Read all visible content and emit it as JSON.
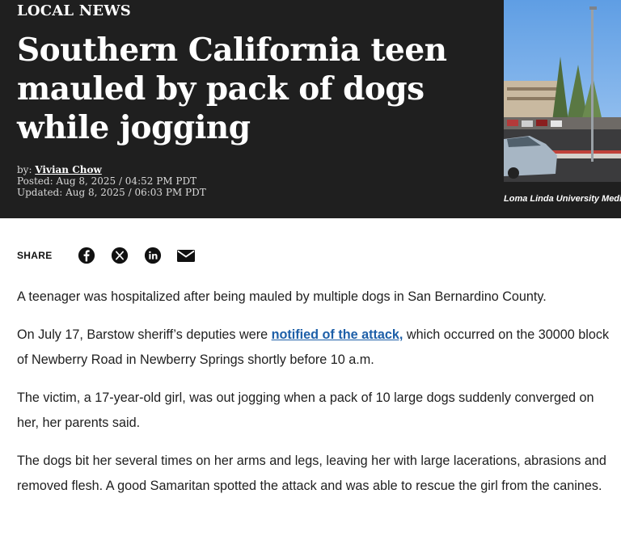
{
  "hero": {
    "kicker": "LOCAL NEWS",
    "headline": "Southern California teen mauled by pack of dogs while jogging",
    "byline_prefix": "by: ",
    "author": "Vivian Chow",
    "posted": "Posted: Aug 8, 2025 / 04:52 PM PDT",
    "updated": "Updated: Aug 8, 2025 / 06:03 PM PDT",
    "photo_caption": "Loma Linda University Medical Center",
    "colors": {
      "background": "#1f1f1f",
      "text": "#ffffff"
    }
  },
  "share": {
    "label": "SHARE",
    "icons": [
      "facebook-icon",
      "x-icon",
      "linkedin-icon",
      "email-icon"
    ]
  },
  "article": {
    "p1": "A teenager was hospitalized after being mauled by multiple dogs in San Bernardino County.",
    "p2_before": "On July 17, Barstow sheriff’s deputies were ",
    "p2_link": "notified of the attack,",
    "p2_after": " which occurred on the 30000 block of Newberry Road in Newberry Springs shortly before 10 a.m.",
    "p3": "The victim, a 17-year-old girl, was out jogging when a pack of 10 large dogs suddenly converged on her, her parents said.",
    "p4": "The dogs bit her several times on her arms and legs, leaving her with large lacerations, abrasions and removed flesh. A good Samaritan spotted the attack and was able to rescue the girl from the canines.",
    "link_color": "#1d5fa8"
  }
}
